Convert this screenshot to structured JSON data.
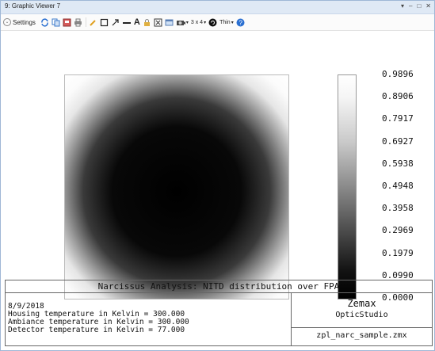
{
  "window": {
    "title": "9: Graphic Viewer 7",
    "controls": [
      "▾",
      "–",
      "□",
      "✕"
    ]
  },
  "toolbar": {
    "settings_label": "Settings",
    "grid_label": "3 x 4",
    "thin_label": "Thin"
  },
  "colorbar": {
    "ticks": [
      "0.9896",
      "0.8906",
      "0.7917",
      "0.6927",
      "0.5938",
      "0.4948",
      "0.3958",
      "0.2969",
      "0.1979",
      "0.0990",
      "0.0000"
    ]
  },
  "info": {
    "title": "Narcissus Analysis: NITD distribution over FPA",
    "lines": [
      "8/9/2018",
      "Housing temperature in Kelvin = 300.000",
      "Ambiance temperature in Kelvin = 300.000",
      "Detector temperature in Kelvin = 77.000"
    ],
    "brand": "Zemax",
    "product": "OpticStudio",
    "file": "zpl_narc_sample.zmx"
  }
}
